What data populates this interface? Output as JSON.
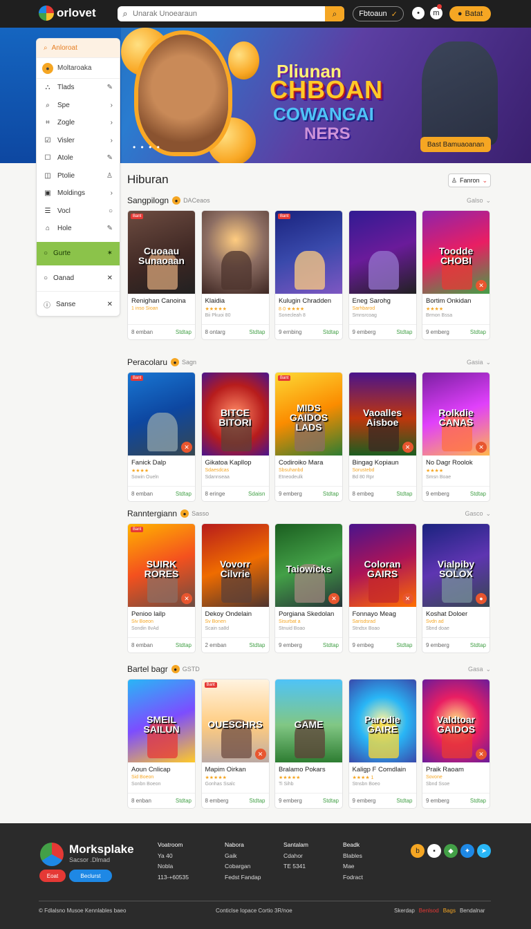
{
  "header": {
    "logo_text": "orlovet",
    "search_placeholder": "Unarak Unoearaun",
    "pill_label": "Fbtoaun",
    "login_label": "Batat"
  },
  "hero": {
    "line1": "Pliunan",
    "line2": "CHBOAN",
    "line3": "COWANGAI",
    "line4": "NERS",
    "cta_label": "Bast Bamuaoanan",
    "dots": "• • • •"
  },
  "sidebar": {
    "header_label": "Anloroat",
    "sub_label": "Moltaroaka",
    "items": [
      {
        "label": "Tlads",
        "icon": "pen-icon",
        "glyph": "⛬",
        "trail": "✎"
      },
      {
        "label": "Spe",
        "icon": "search-icon",
        "glyph": "⌕",
        "trail": "›"
      },
      {
        "label": "Zogle",
        "icon": "grid-icon",
        "glyph": "⌗",
        "trail": "›"
      },
      {
        "label": "Visler",
        "icon": "checkbox-icon",
        "glyph": "☑",
        "trail": "›"
      },
      {
        "label": "Atole",
        "icon": "square-icon",
        "glyph": "☐",
        "trail": "✎"
      },
      {
        "label": "Ptolie",
        "icon": "book-icon",
        "glyph": "◫",
        "trail": "♙"
      },
      {
        "label": "Moldings",
        "icon": "image-icon",
        "glyph": "▣",
        "trail": "›"
      },
      {
        "label": "Vocl",
        "icon": "list-icon",
        "glyph": "☰",
        "trail": "○"
      },
      {
        "label": "Hole",
        "icon": "home-icon",
        "glyph": "⌂",
        "trail": "✎"
      }
    ],
    "active": {
      "label": "Gurte",
      "trail": "✶"
    },
    "extra": [
      {
        "label": "Oanad",
        "trail": "✕"
      },
      {
        "label": "Sanse",
        "trail": "✕"
      }
    ]
  },
  "main": {
    "title": "Hiburan",
    "filter_label": "Fanron"
  },
  "sections": [
    {
      "title": "Sangpilogn",
      "sub": "DACeaos",
      "more": "Galso",
      "cards": [
        {
          "title": "Renighan Canoina",
          "stars": "1 inso Sioan",
          "meta": "",
          "count": "8 emban",
          "price": "Stdtap",
          "tag": "Bant",
          "art": "Cuoaau Sunaoaan",
          "bg": "linear-gradient(160deg,#6d4c41,#3e2723 60%,#212121)",
          "fig": "#d7a47a",
          "act": ""
        },
        {
          "title": "Klaidia",
          "stars": "★★★★★",
          "meta": "Bii Pkuoi 80",
          "count": "8 ontarg",
          "price": "Stdtap",
          "tag": "",
          "art": "",
          "bg": "radial-gradient(circle at 50% 35%,#ffcc80,#8d6e63 45%,#3e2723)",
          "fig": "#4e342e",
          "act": ""
        },
        {
          "title": "Kulugin Chradden",
          "stars": "8·0 ★★★★",
          "meta": "Sonecleah 8",
          "count": "9 ernbing",
          "price": "Stdtap",
          "tag": "Bant",
          "art": "",
          "bg": "linear-gradient(160deg,#1a237e,#3949ab 50%,#7e57c2)",
          "fig": "#ffcc80",
          "act": ""
        },
        {
          "title": "Eneg Sarohg",
          "stars": "Sarhbarod",
          "meta": "Smnsrcoag",
          "count": "9 emberg",
          "price": "Stdtap",
          "tag": "",
          "art": "",
          "bg": "linear-gradient(160deg,#311b92,#6a1b9a 50%,#212121)",
          "fig": "#9575cd",
          "act": ""
        },
        {
          "title": "Bortim Onkidan",
          "stars": "★★★★",
          "meta": "Brmon Bssa",
          "count": "9 emberg",
          "price": "Stdtap",
          "tag": "",
          "art": "Toodde CHOBI",
          "bg": "linear-gradient(160deg,#8e24aa,#e91e63 50%,#43a047)",
          "fig": "#e53935",
          "act": "✕"
        }
      ]
    },
    {
      "title": "Peracolaru",
      "sub": "Sagn",
      "more": "Gasia",
      "cards": [
        {
          "title": "Fanick Dalp",
          "stars": "★★★★",
          "meta": "Sowin Oueln",
          "count": "8 emban",
          "price": "Stdtap",
          "tag": "Bant",
          "art": "",
          "bg": "linear-gradient(160deg,#1976d2,#0d47a1 50%,#37474f)",
          "fig": "#90a4ae",
          "act": "✕"
        },
        {
          "title": "Gikatoa Kapllop",
          "stars": "Sdaesdcas",
          "meta": "Sdannseaa",
          "count": "8 eringe",
          "price": "Sdaisn",
          "tag": "",
          "art": "BITCE BITORI",
          "bg": "radial-gradient(circle at 50% 50%,#ff8a65,#b71c1c 55%,#4a148c)",
          "fig": "#5d4037",
          "act": ""
        },
        {
          "title": "Codiroiko Mara",
          "stars": "Sbsuhanbd",
          "meta": "Etneodeulk",
          "count": "9 emberg",
          "price": "Stdtap",
          "tag": "Bant",
          "art": "MIDS GAIDOS LADS",
          "bg": "linear-gradient(160deg,#fdd835,#fb8c00 50%,#2e7d32)",
          "fig": "#8d6e63",
          "act": ""
        },
        {
          "title": "Bingag Kopiaun",
          "stars": "Sorustebd",
          "meta": "Bd 80 Rpr",
          "count": "8 embeg",
          "price": "Stdtap",
          "tag": "",
          "art": "Vaoalles Aisboe",
          "bg": "linear-gradient(180deg,#4a148c,#bf360c 55%,#1b5e20)",
          "fig": "#3e2723",
          "act": "✕"
        },
        {
          "title": "No Dagr Roolok",
          "stars": "★★★★",
          "meta": "Smsn Boae",
          "count": "9 emberg",
          "price": "Stdtap",
          "tag": "",
          "art": "Rolkdie CANAS",
          "bg": "linear-gradient(160deg,#7b1fa2,#e040fb 50%,#ffb74d)",
          "fig": "#ff7043",
          "act": "✕"
        }
      ]
    },
    {
      "title": "Ranntergiann",
      "sub": "Sasso",
      "more": "Gasco",
      "cards": [
        {
          "title": "Penioo lailp",
          "stars": "Siv Boeon",
          "meta": "Sondin 8vAd",
          "count": "8 emban",
          "price": "Stdtap",
          "tag": "Bant",
          "art": "SUIRK RORES",
          "bg": "linear-gradient(160deg,#ffb300,#f4511e 50%,#6d4c41)",
          "fig": "#8d6e63",
          "act": "✕"
        },
        {
          "title": "Dekoy Ondelain",
          "stars": "Sv Bonen",
          "meta": "Scain sa8d",
          "count": "2 emban",
          "price": "Stdtap",
          "tag": "",
          "art": "Vovorr Cilvrie",
          "bg": "linear-gradient(160deg,#b71c1c,#ef6c00 50%,#4e342e)",
          "fig": "#5d4037",
          "act": ""
        },
        {
          "title": "Porgiana Skedolan",
          "stars": "Sisurbat a",
          "meta": "Stnuid Boao",
          "count": "9 emberg",
          "price": "Stdtap",
          "tag": "",
          "art": "Taiowicks",
          "bg": "linear-gradient(160deg,#1b5e20,#43a047 50%,#263238)",
          "fig": "#a1887f",
          "act": "✕"
        },
        {
          "title": "Fonnayo Meag",
          "stars": "Sarisdsrad",
          "meta": "Stndsx Boao",
          "count": "9 embeg",
          "price": "Stdtap",
          "tag": "",
          "art": "Coloran GAIRS",
          "bg": "linear-gradient(160deg,#4a148c,#ad1457 50%,#ff6f00)",
          "fig": "#c62828",
          "act": "✕"
        },
        {
          "title": "Koshat Doloer",
          "stars": "Svdn ad",
          "meta": "Sbnd doae",
          "count": "9 emberg",
          "price": "Stdtap",
          "tag": "",
          "art": "Vialpiby SOLOX",
          "bg": "linear-gradient(160deg,#1a237e,#5e35b1 50%,#37474f)",
          "fig": "#78909c",
          "act": "●"
        }
      ]
    },
    {
      "title": "Bartel bagr",
      "sub": "GSTD",
      "more": "Gasa",
      "cards": [
        {
          "title": "Aoun Cnlicap",
          "stars": "Sid Boeon",
          "meta": "Sonbn Boeon",
          "count": "8 enban",
          "price": "Stdtap",
          "tag": "",
          "art": "SMEIL SAILUN",
          "bg": "linear-gradient(160deg,#29b6f6,#7c4dff 50%,#ffca28)",
          "fig": "#e53935",
          "act": ""
        },
        {
          "title": "Mapim Oirkan",
          "stars": "★★★★★",
          "meta": "Gonhas Ssalc",
          "count": "8 emberg",
          "price": "Stdtap",
          "tag": "Bant",
          "art": "OUESCHRS",
          "bg": "linear-gradient(180deg,#fff3e0,#ffcc80 55%,#bcaaa4)",
          "fig": "#6d4c41",
          "act": "✕"
        },
        {
          "title": "Bralamo Pokars",
          "stars": "★★★★★",
          "meta": "Ti Sihb",
          "count": "9 emberg",
          "price": "Stdtap",
          "tag": "",
          "art": "GAME",
          "bg": "linear-gradient(180deg,#4fc3f7,#81c784 55%,#2e7d32)",
          "fig": "#5d4037",
          "act": ""
        },
        {
          "title": "Kaligp F Comdlain",
          "stars": "★★★★ 1",
          "meta": "Stnsbn Boeo",
          "count": "9 emberg",
          "price": "Stdtap",
          "tag": "",
          "art": "Parodie GAIRE",
          "bg": "radial-gradient(circle at 50% 50%,#fff59d,#29b6f6 45%,#3949ab)",
          "fig": "#fdd835",
          "act": ""
        },
        {
          "title": "Praik Raoam",
          "stars": "Sovone",
          "meta": "Sbnd Ssoe",
          "count": "9 emberg",
          "price": "Stdtap",
          "tag": "",
          "art": "Valdtoar GAIDOS",
          "bg": "radial-gradient(circle at 50% 50%,#ffe082,#e91e63 45%,#6a1b9a)",
          "fig": "#e53935",
          "act": "✕"
        }
      ]
    }
  ],
  "footer": {
    "brand": "Morksplake",
    "tagline": "Sacsor .Dlmad",
    "btn1": "Eoat",
    "btn2": "Beclurst",
    "col1": [
      "Voatroom",
      "Ya 40",
      "Nobla",
      "113-+60535"
    ],
    "col2": [
      "Nabora",
      "Gaik",
      "Cobargan",
      "Fedst Fandap"
    ],
    "col3": [
      "Santalam",
      "Cdahor",
      "TE 5341"
    ],
    "col4": [
      "Beadk",
      "Blables",
      "Mae",
      "Fodract"
    ],
    "copyright": "Fdlalsno Musoe Kennlables baeo",
    "middle": "Conticlse Iopace Cortio 3R/noe",
    "links": [
      "Skerdap",
      "Benlsod",
      "Bags",
      "Bendalnar"
    ]
  }
}
